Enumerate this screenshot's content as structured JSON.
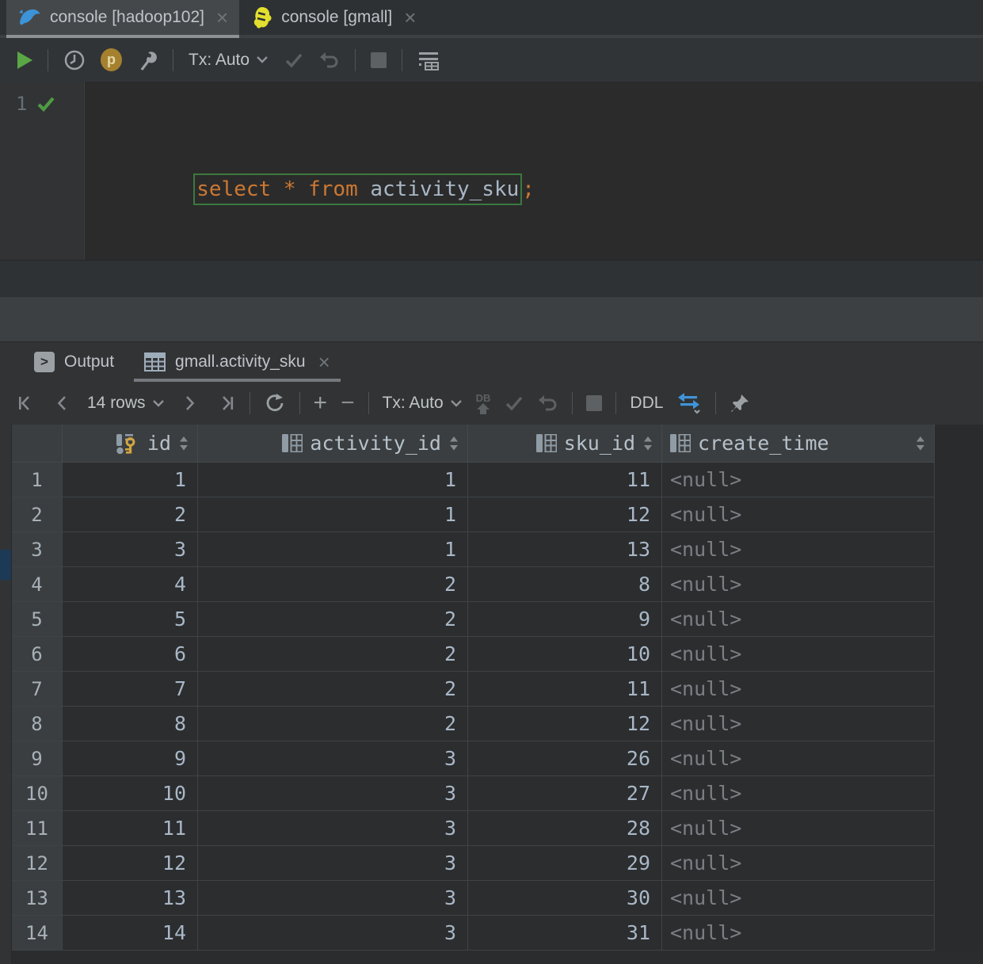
{
  "editor_tabs": {
    "tab1": {
      "label": "console [hadoop102]",
      "close": "×"
    },
    "tab2": {
      "label": "console [gmall]",
      "close": "×"
    }
  },
  "editor_toolbar": {
    "tx": "Tx: Auto",
    "profiler_badge": "p"
  },
  "editor": {
    "line_number": "1",
    "code": {
      "kw_select": "select",
      "star": "*",
      "kw_from": "from",
      "table_name": "activity_sku",
      "semicolon": ";"
    }
  },
  "panel_tabs": {
    "output": "Output",
    "result": "gmall.activity_sku",
    "close": "×"
  },
  "results_toolbar": {
    "rows": "14 rows",
    "tx": "Tx: Auto",
    "db": "DB",
    "ddl": "DDL"
  },
  "table": {
    "columns": [
      {
        "name": "id"
      },
      {
        "name": "activity_id"
      },
      {
        "name": "sku_id"
      },
      {
        "name": "create_time"
      }
    ],
    "rows": [
      {
        "num": "1",
        "id": "1",
        "activity_id": "1",
        "sku_id": "11",
        "create_time": "<null>"
      },
      {
        "num": "2",
        "id": "2",
        "activity_id": "1",
        "sku_id": "12",
        "create_time": "<null>"
      },
      {
        "num": "3",
        "id": "3",
        "activity_id": "1",
        "sku_id": "13",
        "create_time": "<null>"
      },
      {
        "num": "4",
        "id": "4",
        "activity_id": "2",
        "sku_id": "8",
        "create_time": "<null>"
      },
      {
        "num": "5",
        "id": "5",
        "activity_id": "2",
        "sku_id": "9",
        "create_time": "<null>"
      },
      {
        "num": "6",
        "id": "6",
        "activity_id": "2",
        "sku_id": "10",
        "create_time": "<null>"
      },
      {
        "num": "7",
        "id": "7",
        "activity_id": "2",
        "sku_id": "11",
        "create_time": "<null>"
      },
      {
        "num": "8",
        "id": "8",
        "activity_id": "2",
        "sku_id": "12",
        "create_time": "<null>"
      },
      {
        "num": "9",
        "id": "9",
        "activity_id": "3",
        "sku_id": "26",
        "create_time": "<null>"
      },
      {
        "num": "10",
        "id": "10",
        "activity_id": "3",
        "sku_id": "27",
        "create_time": "<null>"
      },
      {
        "num": "11",
        "id": "11",
        "activity_id": "3",
        "sku_id": "28",
        "create_time": "<null>"
      },
      {
        "num": "12",
        "id": "12",
        "activity_id": "3",
        "sku_id": "29",
        "create_time": "<null>"
      },
      {
        "num": "13",
        "id": "13",
        "activity_id": "3",
        "sku_id": "30",
        "create_time": "<null>"
      },
      {
        "num": "14",
        "id": "14",
        "activity_id": "3",
        "sku_id": "31",
        "create_time": "<null>"
      }
    ]
  },
  "colors": {
    "keyword_orange": "#cc7832",
    "identifier": "#a9b7c6",
    "accent_blue": "#3f94d9",
    "key_gold": "#d3a53f",
    "play_green": "#5aa746",
    "bulb_orange": "#e8a33d",
    "editor_bg": "#2b2b2b",
    "panel_bg": "#313335"
  }
}
